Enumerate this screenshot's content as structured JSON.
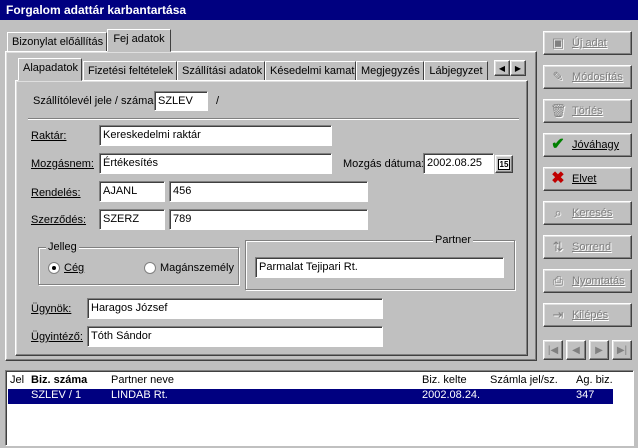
{
  "window": {
    "title": "Forgalom adattár karbantartása"
  },
  "outer_tabs": [
    {
      "label": "Bizonylat előállítás"
    },
    {
      "label": "Fej adatok"
    }
  ],
  "inner_tabs": [
    {
      "label": "Alapadatok"
    },
    {
      "label": "Fizetési feltételek"
    },
    {
      "label": "Szállítási adatok"
    },
    {
      "label": "Késedelmi kamat"
    },
    {
      "label": "Megjegyzés"
    },
    {
      "label": "Lábjegyzet"
    }
  ],
  "tab_scroll": {
    "left": "◀",
    "right": "▶"
  },
  "form": {
    "szallitolevel_label": "Szállítólevél jele / száma:",
    "szallitolevel_value": "SZLEV",
    "szallitolevel_sep": "/",
    "raktar_label": "Raktár:",
    "raktar_value": "Kereskedelmi raktár",
    "mozgasnem_label": "Mozgásnem:",
    "mozgasnem_value": "Értékesítés",
    "mozgas_datuma_label": "Mozgás dátuma:",
    "mozgas_datuma_value": "2002.08.25",
    "calendar_btn": "15",
    "rendeles_label": "Rendelés:",
    "rendeles_code": "AJANL",
    "rendeles_num": "456",
    "szerzodes_label": "Szerződés:",
    "szerzodes_code": "SZERZ",
    "szerzodes_num": "789",
    "jelleg_title": "Jelleg",
    "ceg_label": "Cég",
    "maganszemely_label": "Magánszemély",
    "partner_title": "Partner",
    "partner_value": "Parmalat Tejipari Rt.",
    "ugynok_label": "Ügynök:",
    "ugynok_value": "Haragos József",
    "ugyintezo_label": "Ügyintéző:",
    "ugyintezo_value": "Tóth Sándor"
  },
  "buttons": {
    "uj_adat": "Új adat",
    "modositas": "Módosítás",
    "torles": "Törlés",
    "jovahagy": "Jóváhagy",
    "elvet": "Elvet",
    "kereses": "Keresés",
    "sorrend": "Sorrend",
    "nyomtatas": "Nyomtatás",
    "kilepes": "Kilépés"
  },
  "nav": {
    "first": "|◀",
    "prev": "◀",
    "next": "▶",
    "last": "▶|"
  },
  "grid": {
    "headers": [
      "Jel",
      "Biz. száma",
      "Partner neve",
      "Biz. kelte",
      "Számla jel/sz.",
      "Ag. biz."
    ],
    "rows": [
      [
        "",
        "SZLEV / 1",
        "LINDAB Rt.",
        "2002.08.24.",
        "",
        "347"
      ]
    ]
  },
  "colors": {
    "title_bg": "#000080",
    "selection": "#000080",
    "accept_green": "#008000",
    "reject_red": "#c00000"
  }
}
